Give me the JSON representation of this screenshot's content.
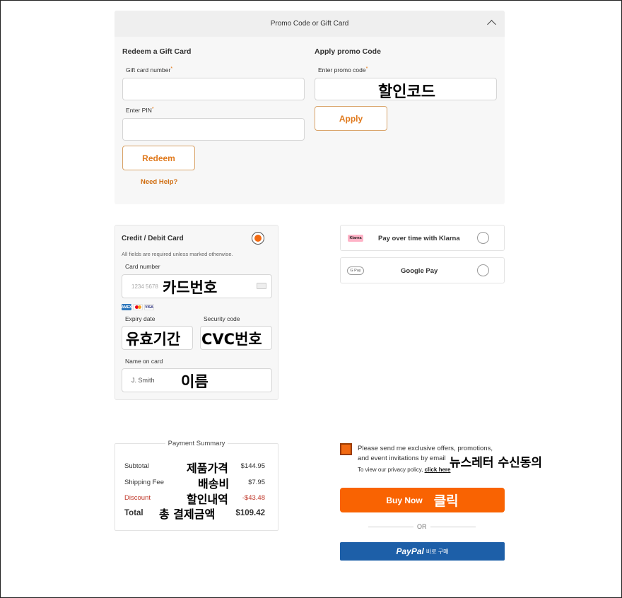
{
  "promo": {
    "header": "Promo Code or Gift Card",
    "gift": {
      "title": "Redeem a Gift Card",
      "number_label": "Gift card number",
      "pin_label": "Enter PIN",
      "redeem_button": "Redeem",
      "help_link": "Need Help?"
    },
    "code": {
      "title": "Apply promo Code",
      "code_label": "Enter promo code",
      "apply_button": "Apply"
    },
    "required_mark": "*"
  },
  "card": {
    "title": "Credit / Debit Card",
    "note": "All fields are required unless marked otherwise.",
    "number_label": "Card number",
    "number_placeholder": "1234 5678",
    "expiry_label": "Expiry date",
    "security_label": "Security code",
    "name_label": "Name on card",
    "name_placeholder": "J. Smith",
    "card_brands": [
      "AMEX",
      "MC",
      "VISA"
    ]
  },
  "methods": {
    "klarna": {
      "logo": "Klarna",
      "label": "Pay over time with Klarna"
    },
    "gpay": {
      "logo": "G Pay",
      "label": "Google Pay"
    }
  },
  "summary": {
    "title": "Payment Summary",
    "rows": [
      {
        "label": "Subtotal",
        "value": "$144.95"
      },
      {
        "label": "Shipping Fee",
        "value": "$7.95"
      },
      {
        "label": "Discount",
        "value": "-$43.48"
      },
      {
        "label": "Total",
        "value": "$109.42"
      }
    ]
  },
  "consent": {
    "text_line1": "Please send me exclusive offers, promotions,",
    "text_line2": "and event invitations by email",
    "privacy_text": "To view our privacy policy, ",
    "privacy_link": "click here"
  },
  "buy_button": "Buy Now",
  "or_text": "OR",
  "paypal": {
    "logo": "PayPal",
    "suffix": "바로 구매"
  },
  "annotations": {
    "promo_code": "할인코드",
    "card_number": "카드번호",
    "expiry": "유효기간",
    "cvc": "CVC번호",
    "name": "이름",
    "subtotal": "제품가격",
    "shipping": "배송비",
    "discount": "할인내역",
    "total": "총 결제금액",
    "newsletter": "뉴스레터 수신동의",
    "click": "클릭"
  },
  "colors": {
    "accent": "#f96302",
    "discount_red": "#c0392b",
    "paypal_blue": "#1d5fa8"
  }
}
